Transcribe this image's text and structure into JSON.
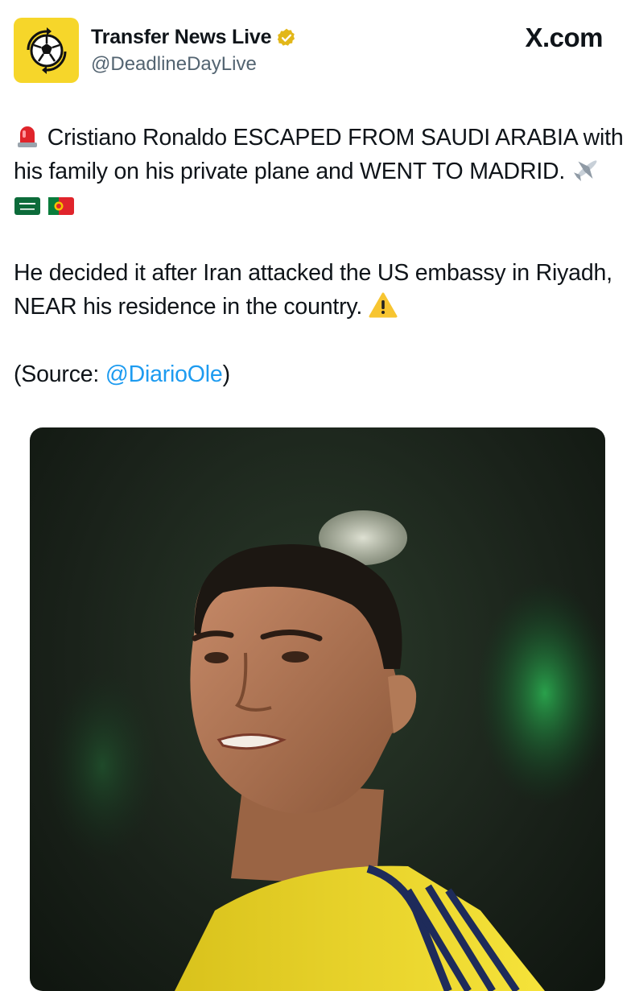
{
  "header": {
    "display_name": "Transfer News Live",
    "handle": "@DeadlineDayLive",
    "site_brand": "X.com",
    "verified": true
  },
  "tweet": {
    "line1": "Cristiano Ronaldo ESCAPED FROM SAUDI ARABIA with his family on his private plane and WENT TO MADRID.",
    "emojis_line1": [
      "rotating-light-icon",
      "airplane-icon",
      "saudi-flag-icon",
      "portugal-flag-icon"
    ],
    "para2": "He decided it after Iran attacked the US embassy in Riyadh, NEAR his residence in the country.",
    "emoji_para2": "warning-icon",
    "source_prefix": "(Source: ",
    "source_mention": "@DiarioOle",
    "source_suffix": ")"
  },
  "colors": {
    "accent": "#1d9bf0",
    "avatar_bg": "#f6d62a",
    "verified_badge": "#e2b719",
    "jersey": "#f2dd2a"
  }
}
